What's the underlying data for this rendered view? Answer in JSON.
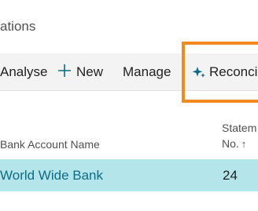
{
  "page": {
    "title": "ations"
  },
  "actions": {
    "analyse": "Analyse",
    "new_label": "New",
    "new_icon": "plus-icon",
    "manage": "Manage",
    "reconcile_label": "Reconcil",
    "reconcile_icon": "sparkle-icon"
  },
  "highlight": {
    "color": "#f28a1e"
  },
  "table": {
    "columns": {
      "bank_account_name": "Bank Account Name",
      "statement_line1": "Statem",
      "statement_line2": "No.",
      "sort_icon": "sort-ascending-arrow-icon"
    },
    "rows": [
      {
        "bank_account_name": "World Wide Bank",
        "statement_no": "24",
        "selected": true
      }
    ]
  },
  "colors": {
    "accent": "#0f6c85",
    "selected_row": "#b3e5ea",
    "action_bar": "#f3f3f3"
  }
}
